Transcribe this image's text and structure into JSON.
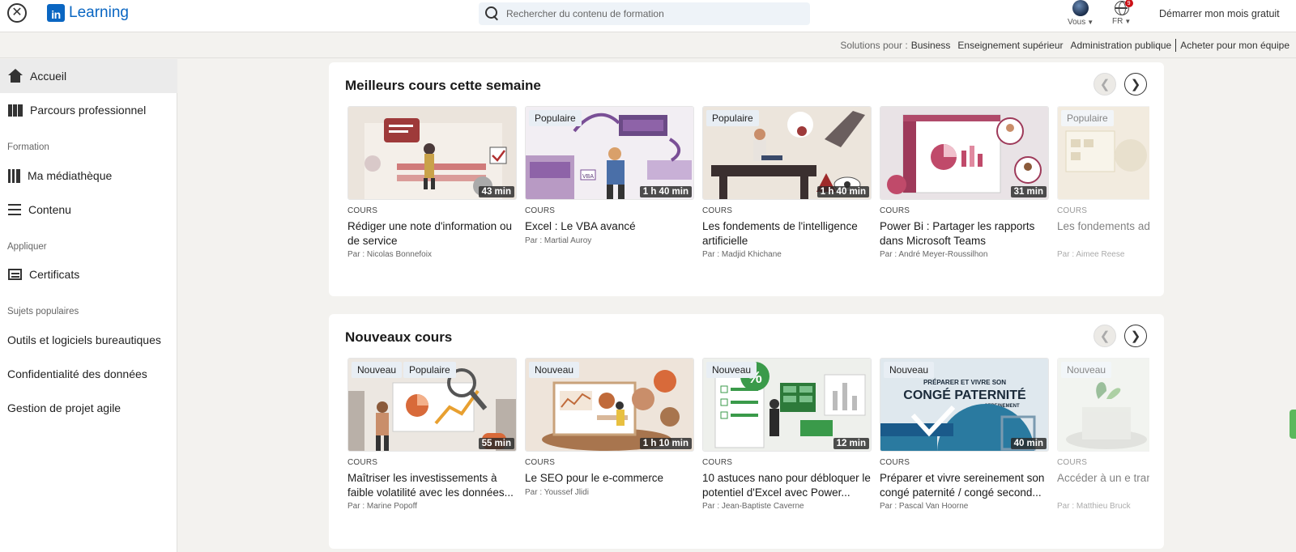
{
  "header": {
    "close_label": "✕",
    "logo_box": "in",
    "logo_text": "Learning",
    "search_placeholder": "Rechercher du contenu de formation",
    "nav_me": "Vous",
    "nav_lang": "FR",
    "notif_count": "9",
    "cta": "Démarrer mon mois gratuit"
  },
  "solutions": {
    "label": "Solutions pour :",
    "items": [
      "Business",
      "Enseignement supérieur",
      "Administration publique",
      "Acheter pour mon équipe"
    ]
  },
  "sidebar": {
    "accueil": "Accueil",
    "parcours": "Parcours professionnel",
    "section_formation": "Formation",
    "mediatheque": "Ma médiathèque",
    "contenu": "Contenu",
    "section_appliquer": "Appliquer",
    "certificats": "Certificats",
    "section_sujets": "Sujets populaires",
    "topics": [
      "Outils et logiciels bureautiques",
      "Confidentialité des données",
      "Gestion de projet agile"
    ]
  },
  "sections": [
    {
      "title": "Meilleurs cours cette semaine",
      "cards": [
        {
          "badge": "",
          "duration": "43 min",
          "type": "COURS",
          "title": "Rédiger une note d'information ou de service",
          "author": "Par : Nicolas Bonnefoix"
        },
        {
          "badge": "Populaire",
          "duration": "1 h 40 min",
          "type": "COURS",
          "title": "Excel : Le VBA avancé",
          "author": "Par : Martial Auroy"
        },
        {
          "badge": "Populaire",
          "duration": "1 h 40 min",
          "type": "COURS",
          "title": "Les fondements de l'intelligence artificielle",
          "author": "Par : Madjid Khichane"
        },
        {
          "badge": "",
          "duration": "31 min",
          "type": "COURS",
          "title": "Power Bi : Partager les rapports dans Microsoft Teams",
          "author": "Par : André Meyer-Roussilhon"
        },
        {
          "badge": "Populaire",
          "duration": "",
          "type": "COURS",
          "title": "Les fondements administrative",
          "author": "Par : Aimee Reese"
        }
      ]
    },
    {
      "title": "Nouveaux cours",
      "cards": [
        {
          "badge": "Nouveau",
          "badge2": "Populaire",
          "duration": "55 min",
          "type": "COURS",
          "title": "Maîtriser les investissements à faible volatilité avec les données...",
          "author": "Par : Marine Popoff"
        },
        {
          "badge": "Nouveau",
          "duration": "1 h 10 min",
          "type": "COURS",
          "title": "Le SEO pour le e-commerce",
          "author": "Par : Youssef Jlidi"
        },
        {
          "badge": "Nouveau",
          "duration": "12 min",
          "type": "COURS",
          "title": "10 astuces nano pour débloquer le potentiel d'Excel avec Power...",
          "author": "Par : Jean-Baptiste Caverne"
        },
        {
          "badge": "Nouveau",
          "duration": "40 min",
          "type": "COURS",
          "title": "Préparer et vivre sereinement son congé paternité / congé second...",
          "author": "Par : Pascal Van Hoorne"
        },
        {
          "badge": "Nouveau",
          "duration": "",
          "type": "COURS",
          "title": "Accéder à un e transformation",
          "author": "Par : Matthieu Bruck"
        }
      ]
    }
  ],
  "thumb_text": {
    "patern_line1": "PRÉPARER ET VIVRE SON",
    "patern_line2": "CONGÉ PATERNITÉ",
    "patern_line3": "SEREINEMENT",
    "vba": "VBA",
    "percent": "%"
  },
  "colors": {
    "brand": "#0a66c2",
    "notification": "#cc1016"
  }
}
